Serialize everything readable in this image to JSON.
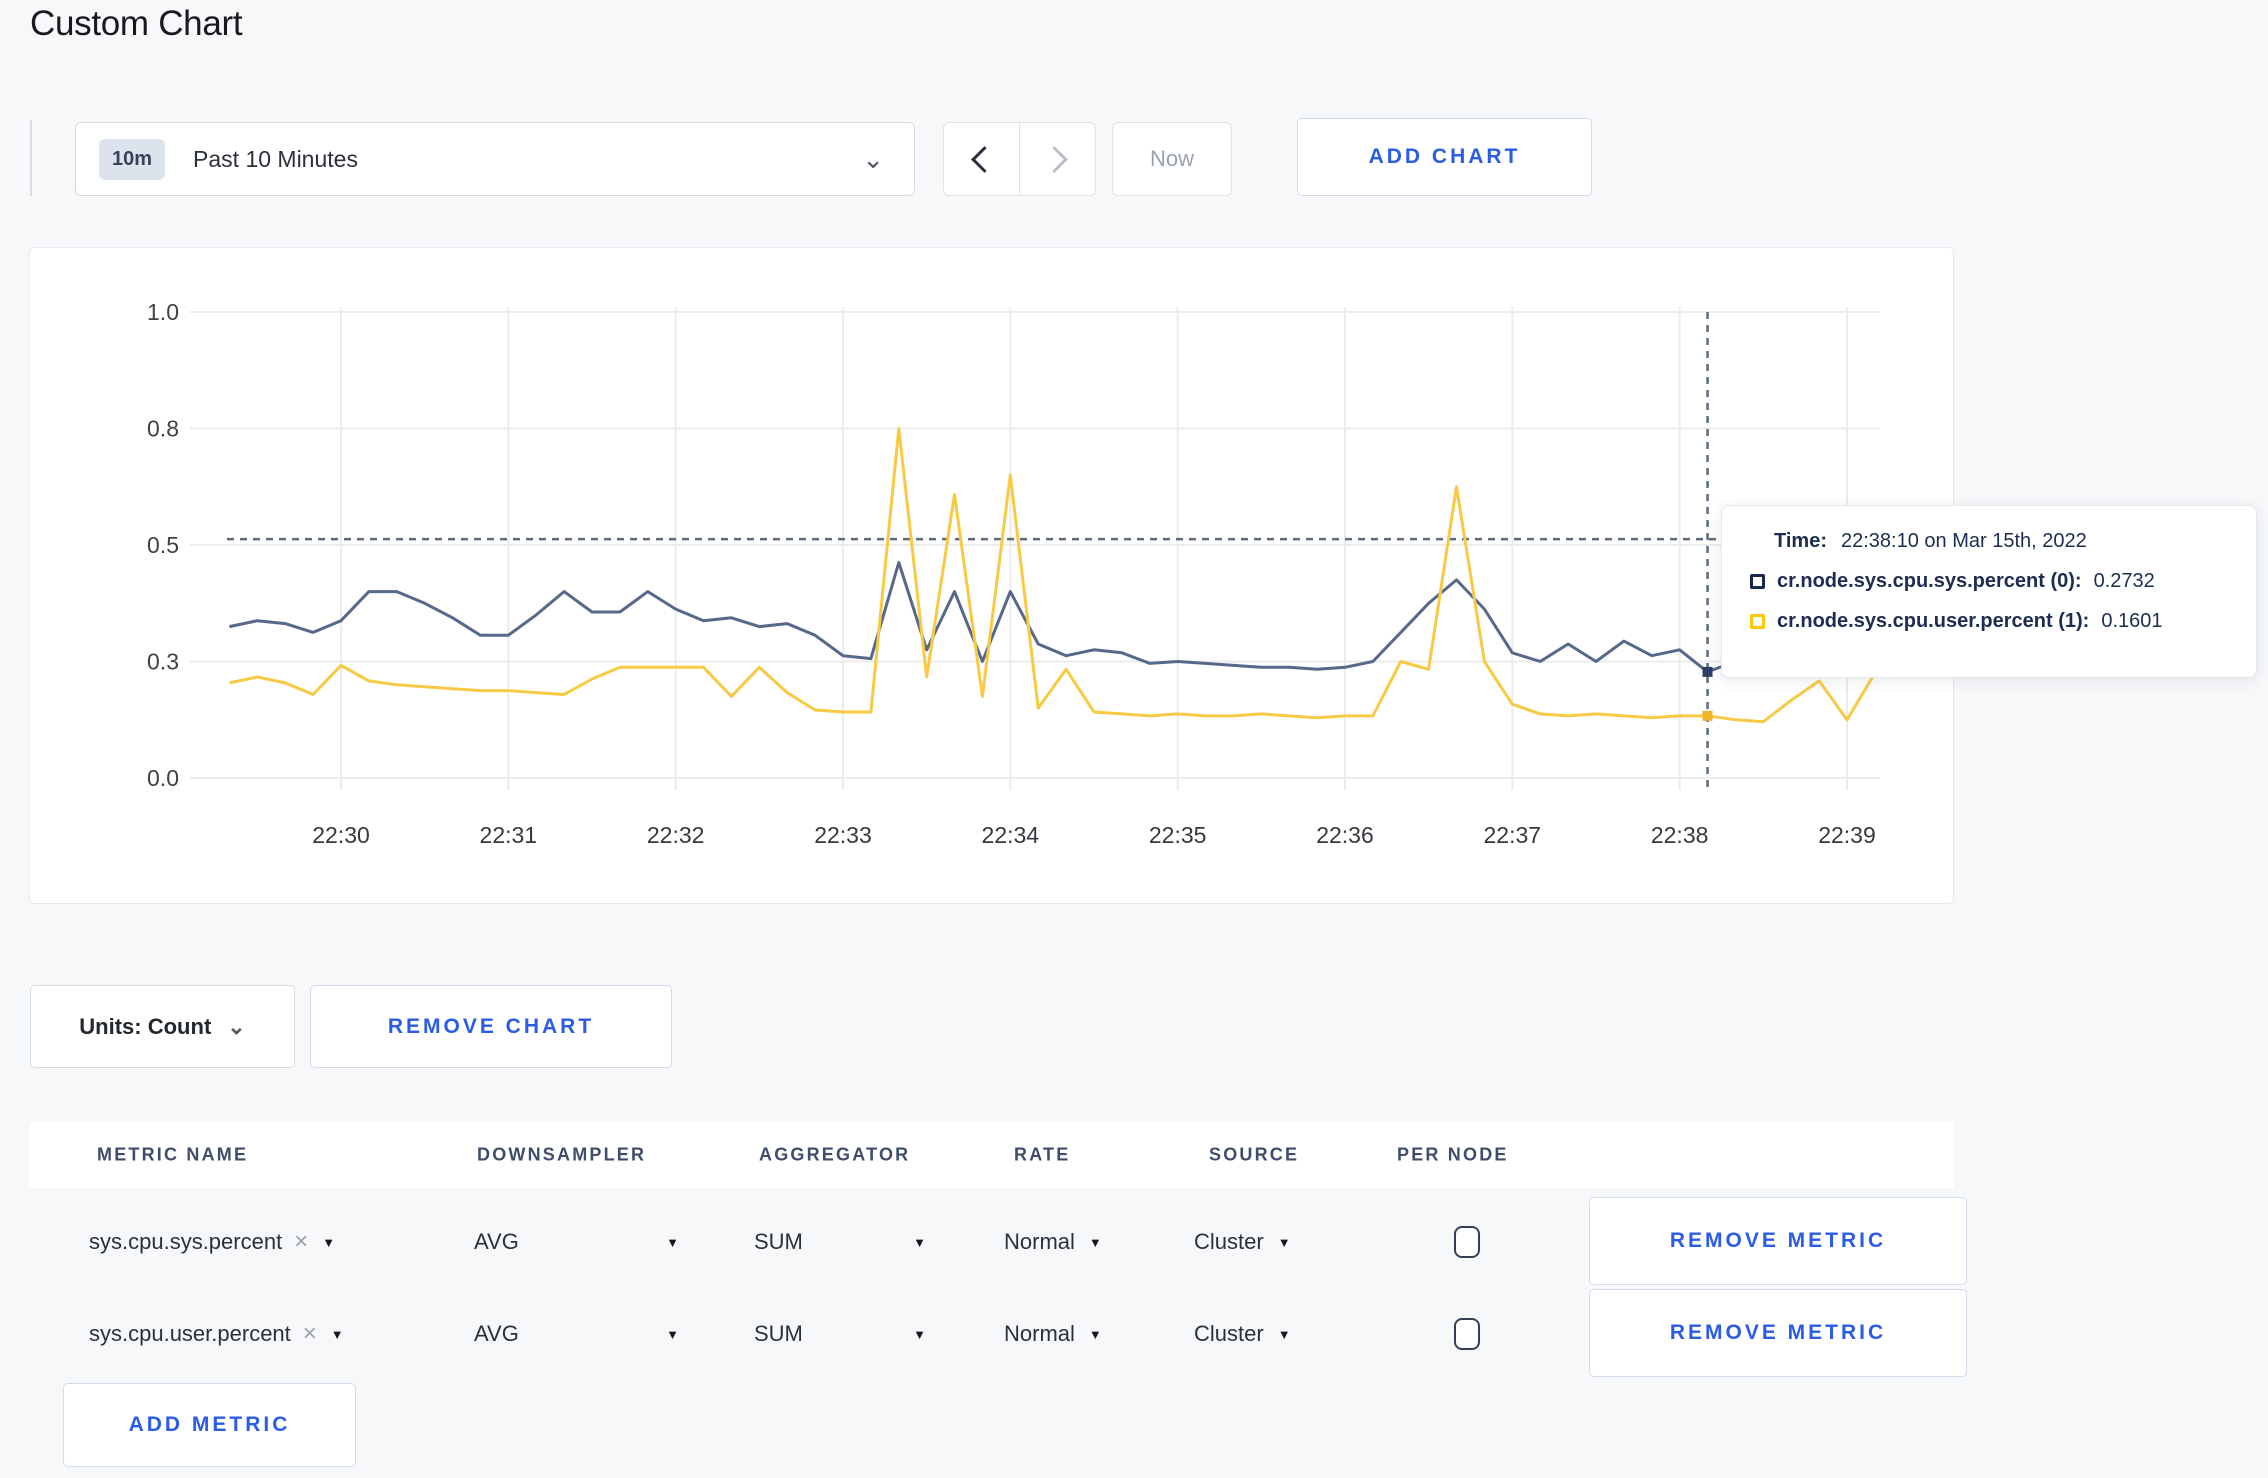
{
  "page": {
    "title": "Custom Chart"
  },
  "toolbar": {
    "time_badge": "10m",
    "time_range_label": "Past 10 Minutes",
    "now_label": "Now",
    "add_chart_label": "ADD CHART"
  },
  "icons": {
    "close": "×",
    "caret_down": "▼",
    "chevron_down": "⌄"
  },
  "colors": {
    "accent_blue": "#2b5ce6",
    "series_sys": "#57688a",
    "series_user": "#f8ca44",
    "grid": "#ececec",
    "crosshair": "#5c6b7e",
    "axis_text": "#3d4249"
  },
  "tooltip": {
    "time_label": "Time:",
    "time_value": "22:38:10 on Mar 15th, 2022",
    "series": [
      {
        "name": "cr.node.sys.cpu.sys.percent (0):",
        "value": "0.2732",
        "color": "#16294d"
      },
      {
        "name": "cr.node.sys.cpu.user.percent (1):",
        "value": "0.1601",
        "color": "#ffc800"
      }
    ]
  },
  "chart_data": {
    "type": "line",
    "title": "",
    "xlabel": "",
    "ylabel": "",
    "ylim": [
      0,
      1
    ],
    "grid": true,
    "y_tick_values": [
      0,
      0.3,
      0.5,
      0.8,
      1.0
    ],
    "y_tick_labels": [
      "0.0",
      "0.3",
      "0.5",
      "0.8",
      "1.0"
    ],
    "x_tick_labels": [
      "22:30",
      "22:31",
      "22:32",
      "22:33",
      "22:34",
      "22:35",
      "22:36",
      "22:37",
      "22:38",
      "22:39"
    ],
    "x": [
      "22:29:20",
      "22:29:30",
      "22:29:40",
      "22:29:50",
      "22:30:00",
      "22:30:10",
      "22:30:20",
      "22:30:30",
      "22:30:40",
      "22:30:50",
      "22:31:00",
      "22:31:10",
      "22:31:20",
      "22:31:30",
      "22:31:40",
      "22:31:50",
      "22:32:00",
      "22:32:10",
      "22:32:20",
      "22:32:30",
      "22:32:40",
      "22:32:50",
      "22:33:00",
      "22:33:10",
      "22:33:20",
      "22:33:30",
      "22:33:40",
      "22:33:50",
      "22:34:00",
      "22:34:10",
      "22:34:20",
      "22:34:30",
      "22:34:40",
      "22:34:50",
      "22:35:00",
      "22:35:10",
      "22:35:20",
      "22:35:30",
      "22:35:40",
      "22:35:50",
      "22:36:00",
      "22:36:10",
      "22:36:20",
      "22:36:30",
      "22:36:40",
      "22:36:50",
      "22:37:00",
      "22:37:10",
      "22:37:20",
      "22:37:30",
      "22:37:40",
      "22:37:50",
      "22:38:00",
      "22:38:10",
      "22:38:20",
      "22:38:30",
      "22:38:40",
      "22:38:50",
      "22:39:00",
      "22:39:10"
    ],
    "series": [
      {
        "name": "cr.node.sys.cpu.sys.percent",
        "color": "#57688a",
        "values": [
          0.36,
          0.37,
          0.365,
          0.35,
          0.37,
          0.42,
          0.42,
          0.4,
          0.375,
          0.345,
          0.345,
          0.38,
          0.42,
          0.385,
          0.385,
          0.42,
          0.39,
          0.37,
          0.375,
          0.36,
          0.365,
          0.345,
          0.31,
          0.305,
          0.47,
          0.32,
          0.42,
          0.3,
          0.42,
          0.33,
          0.31,
          0.32,
          0.315,
          0.295,
          0.3,
          0.295,
          0.29,
          0.285,
          0.285,
          0.28,
          0.285,
          0.3,
          0.35,
          0.4,
          0.44,
          0.39,
          0.315,
          0.3,
          0.33,
          0.3,
          0.335,
          0.31,
          0.32,
          0.2732,
          0.3,
          0.3,
          0.31,
          0.3,
          0.3,
          0.26
        ]
      },
      {
        "name": "cr.node.sys.cpu.user.percent",
        "color": "#f8ca44",
        "values": [
          0.245,
          0.26,
          0.245,
          0.215,
          0.29,
          0.25,
          0.24,
          0.235,
          0.23,
          0.225,
          0.225,
          0.22,
          0.215,
          0.255,
          0.285,
          0.285,
          0.285,
          0.285,
          0.21,
          0.285,
          0.22,
          0.175,
          0.17,
          0.17,
          0.8,
          0.26,
          0.63,
          0.21,
          0.68,
          0.18,
          0.28,
          0.17,
          0.165,
          0.16,
          0.165,
          0.16,
          0.16,
          0.165,
          0.16,
          0.155,
          0.16,
          0.16,
          0.3,
          0.28,
          0.65,
          0.3,
          0.19,
          0.165,
          0.16,
          0.165,
          0.16,
          0.155,
          0.16,
          0.1601,
          0.15,
          0.145,
          0.2,
          0.25,
          0.15,
          0.27
        ]
      }
    ],
    "hover": {
      "index": 53,
      "time": "22:38:10",
      "guideline_value": 0.515
    },
    "legend_position": "tooltip"
  },
  "chart_controls": {
    "units_label": "Units: Count",
    "remove_chart_label": "REMOVE CHART"
  },
  "metrics_table": {
    "headers": [
      "METRIC NAME",
      "DOWNSAMPLER",
      "AGGREGATOR",
      "RATE",
      "SOURCE",
      "PER NODE"
    ],
    "rows": [
      {
        "metric_name": "sys.cpu.sys.percent",
        "downsampler": "AVG",
        "aggregator": "SUM",
        "rate": "Normal",
        "source": "Cluster",
        "per_node_checked": false,
        "remove_label": "REMOVE METRIC"
      },
      {
        "metric_name": "sys.cpu.user.percent",
        "downsampler": "AVG",
        "aggregator": "SUM",
        "rate": "Normal",
        "source": "Cluster",
        "per_node_checked": false,
        "remove_label": "REMOVE METRIC"
      }
    ],
    "add_metric_label": "ADD METRIC"
  }
}
